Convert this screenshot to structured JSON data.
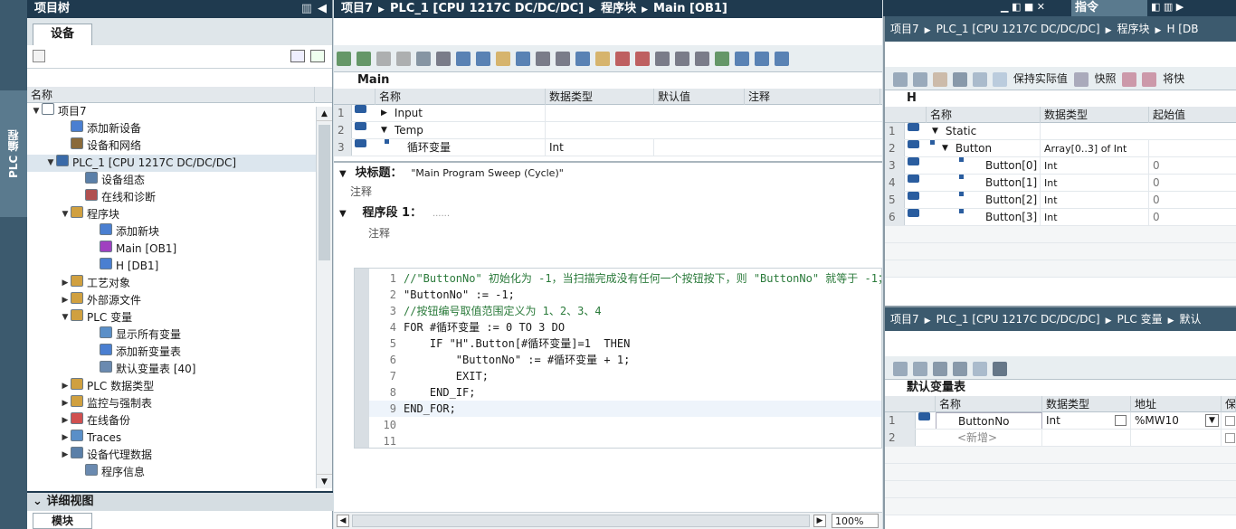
{
  "left": {
    "title": "项目树",
    "tab": "设备",
    "column": "名称",
    "vertical_label": "PLC 编程",
    "items": [
      {
        "label": "项目7",
        "arrow": "▼",
        "indent": 0,
        "color": "#ffffff"
      },
      {
        "label": "添加新设备",
        "arrow": "",
        "indent": 2,
        "color": "#4a7fd1"
      },
      {
        "label": "设备和网络",
        "arrow": "",
        "indent": 2,
        "color": "#8a6a3a"
      },
      {
        "label": "PLC_1 [CPU 1217C DC/DC/DC]",
        "arrow": "▼",
        "indent": 1,
        "color": "#3a6aa8"
      },
      {
        "label": "设备组态",
        "arrow": "",
        "indent": 3,
        "color": "#5a7fa8"
      },
      {
        "label": "在线和诊断",
        "arrow": "",
        "indent": 3,
        "color": "#b05050"
      },
      {
        "label": "程序块",
        "arrow": "▼",
        "indent": 2,
        "color": "#d0a040"
      },
      {
        "label": "添加新块",
        "arrow": "",
        "indent": 4,
        "color": "#4a7fd1"
      },
      {
        "label": "Main [OB1]",
        "arrow": "",
        "indent": 4,
        "color": "#a040c0"
      },
      {
        "label": "H [DB1]",
        "arrow": "",
        "indent": 4,
        "color": "#4a7fd1"
      },
      {
        "label": "工艺对象",
        "arrow": "▶",
        "indent": 2,
        "color": "#d0a040"
      },
      {
        "label": "外部源文件",
        "arrow": "▶",
        "indent": 2,
        "color": "#d0a040"
      },
      {
        "label": "PLC 变量",
        "arrow": "▼",
        "indent": 2,
        "color": "#d0a040"
      },
      {
        "label": "显示所有变量",
        "arrow": "",
        "indent": 4,
        "color": "#5a8fc8"
      },
      {
        "label": "添加新变量表",
        "arrow": "",
        "indent": 4,
        "color": "#4a7fd1"
      },
      {
        "label": "默认变量表 [40]",
        "arrow": "",
        "indent": 4,
        "color": "#6a8ab0"
      },
      {
        "label": "PLC 数据类型",
        "arrow": "▶",
        "indent": 2,
        "color": "#d0a040"
      },
      {
        "label": "监控与强制表",
        "arrow": "▶",
        "indent": 2,
        "color": "#d0a040"
      },
      {
        "label": "在线备份",
        "arrow": "▶",
        "indent": 2,
        "color": "#d05050"
      },
      {
        "label": "Traces",
        "arrow": "▶",
        "indent": 2,
        "color": "#5a8fc8"
      },
      {
        "label": "设备代理数据",
        "arrow": "▶",
        "indent": 2,
        "color": "#5a7fa8"
      },
      {
        "label": "程序信息",
        "arrow": "",
        "indent": 3,
        "color": "#6a8ab0"
      }
    ],
    "detail_title": "详细视图",
    "detail_tab": "模块"
  },
  "main": {
    "breadcrumb": [
      "项目7",
      "PLC_1 [CPU 1217C DC/DC/DC]",
      "程序块",
      "Main [OB1]"
    ],
    "block_name": "Main",
    "cols": [
      "名称",
      "数据类型",
      "默认值",
      "注释"
    ],
    "rows": [
      {
        "n": "1",
        "arrow": "▶",
        "name": "Input",
        "type": ""
      },
      {
        "n": "2",
        "arrow": "▼",
        "name": "Temp",
        "type": ""
      },
      {
        "n": "3",
        "arrow": "",
        "name": "循环变量",
        "type": "Int"
      }
    ],
    "block_title_label": "块标题：",
    "block_title_value": "\"Main Program Sweep (Cycle)\"",
    "comment": "注释",
    "network_label": "程序段 1：",
    "network_dots": "......",
    "network_comment": "注释",
    "code": [
      {
        "n": "1",
        "t": "//\"ButtonNo\" 初始化为 -1，当扫描完成没有任何一个按钮按下，则 \"ButtonNo\" 就等于 -1；"
      },
      {
        "n": "2",
        "t": "\"ButtonNo\" := -1;"
      },
      {
        "n": "3",
        "t": "//按钮编号取值范围定义为 1、2、3、4"
      },
      {
        "n": "4",
        "t": "FOR #循环变量 := 0 TO 3 DO"
      },
      {
        "n": "5",
        "t": "    IF \"H\".Button[#循环变量]=1  THEN"
      },
      {
        "n": "6",
        "t": "        \"ButtonNo\" := #循环变量 + 1;"
      },
      {
        "n": "7",
        "t": "        EXIT;"
      },
      {
        "n": "8",
        "t": "    END_IF;"
      },
      {
        "n": "9",
        "t": "END_FOR;"
      },
      {
        "n": "10",
        "t": ""
      },
      {
        "n": "11",
        "t": ""
      }
    ],
    "zoom": "100%"
  },
  "instr": {
    "title": "指令"
  },
  "db": {
    "breadcrumb": [
      "项目7",
      "PLC_1 [CPU 1217C DC/DC/DC]",
      "程序块",
      "H [DB"
    ],
    "tb_keep": "保持实际值",
    "tb_snapshot": "快照",
    "tb_last": "将快",
    "name": "H",
    "cols": [
      "名称",
      "数据类型",
      "起始值"
    ],
    "rows": [
      {
        "n": "1",
        "arrow": "▼",
        "name": "Static",
        "type": "",
        "start": ""
      },
      {
        "n": "2",
        "arrow": "▼",
        "name": "Button",
        "type": "Array[0..3] of Int",
        "start": ""
      },
      {
        "n": "3",
        "arrow": "",
        "name": "Button[0]",
        "type": "Int",
        "start": "0"
      },
      {
        "n": "4",
        "arrow": "",
        "name": "Button[1]",
        "type": "Int",
        "start": "0"
      },
      {
        "n": "5",
        "arrow": "",
        "name": "Button[2]",
        "type": "Int",
        "start": "0"
      },
      {
        "n": "6",
        "arrow": "",
        "name": "Button[3]",
        "type": "Int",
        "start": "0"
      }
    ]
  },
  "tags": {
    "breadcrumb": [
      "项目7",
      "PLC_1 [CPU 1217C DC/DC/DC]",
      "PLC 变量",
      "默认"
    ],
    "name": "默认变量表",
    "cols": [
      "名称",
      "数据类型",
      "地址",
      "保"
    ],
    "rows": [
      {
        "n": "1",
        "name": "ButtonNo",
        "type": "Int",
        "addr": "%MW10"
      },
      {
        "n": "2",
        "name": "<新增>",
        "type": "",
        "addr": ""
      }
    ]
  }
}
